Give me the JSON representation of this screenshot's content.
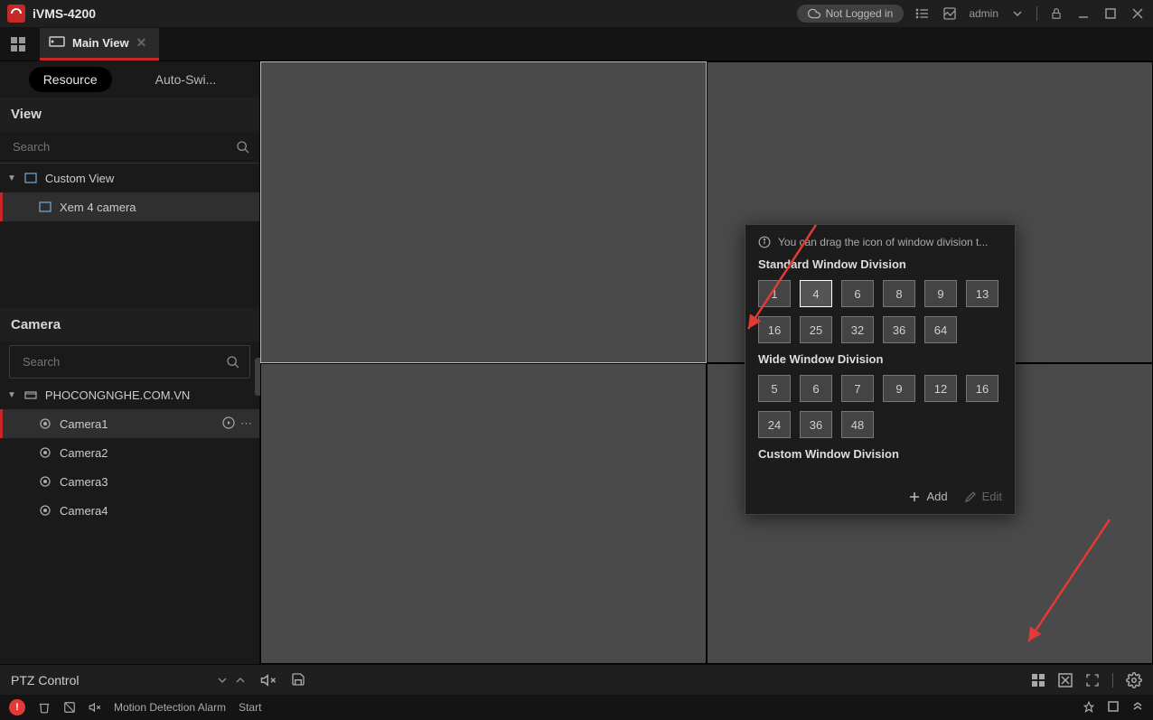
{
  "app": {
    "title": "iVMS-4200"
  },
  "titlebar": {
    "cloud_status": "Not Logged in",
    "user": "admin"
  },
  "tabs": {
    "main_view": "Main View"
  },
  "sidebar": {
    "resource_tab": "Resource",
    "autoswitch_tab": "Auto-Swi...",
    "view_header": "View",
    "view_search_placeholder": "Search",
    "custom_view_label": "Custom View",
    "custom_view_children": [
      {
        "label": "Xem 4 camera"
      }
    ],
    "camera_header": "Camera",
    "camera_search_placeholder": "Search",
    "device_label": "PHOCONGNGHE.COM.VN",
    "cameras": [
      {
        "label": "Camera1"
      },
      {
        "label": "Camera2"
      },
      {
        "label": "Camera3"
      },
      {
        "label": "Camera4"
      }
    ]
  },
  "division_popup": {
    "hint": "You can drag the icon of window division t...",
    "standard_title": "Standard Window Division",
    "standard_options": [
      "1",
      "4",
      "6",
      "8",
      "9",
      "13",
      "16",
      "25",
      "32",
      "36",
      "64"
    ],
    "standard_selected": "4",
    "wide_title": "Wide Window Division",
    "wide_options": [
      "5",
      "6",
      "7",
      "9",
      "12",
      "16",
      "24",
      "36",
      "48"
    ],
    "custom_title": "Custom Window Division",
    "add_label": "Add",
    "edit_label": "Edit"
  },
  "ptz": {
    "label": "PTZ Control"
  },
  "statusbar": {
    "alarm_text": "Motion Detection Alarm",
    "alarm_action": "Start"
  }
}
